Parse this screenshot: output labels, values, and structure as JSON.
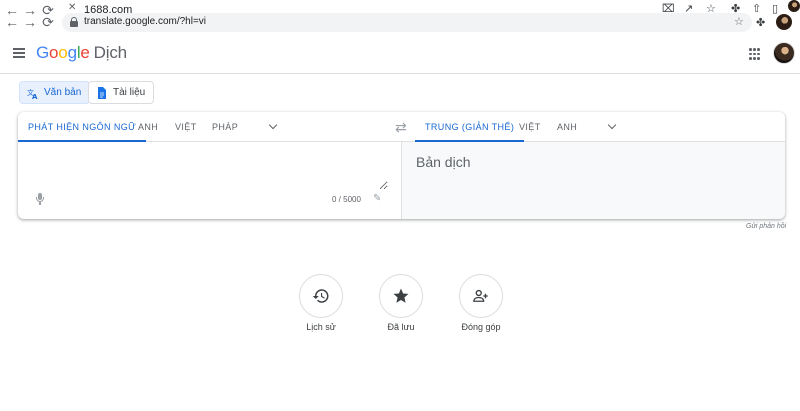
{
  "browser": {
    "tab_title": "1688.com",
    "url": "translate.google.com/?hl=vi"
  },
  "header": {
    "logo_letters": [
      "G",
      "o",
      "o",
      "g",
      "l",
      "e"
    ],
    "product_name": "Dịch"
  },
  "modes": [
    {
      "label": "Văn bản",
      "active": true,
      "icon": "translate-icon"
    },
    {
      "label": "Tài liệu",
      "active": false,
      "icon": "document-icon"
    }
  ],
  "source_langs": [
    {
      "label": "Phát hiện ngôn ngữ",
      "active": true
    },
    {
      "label": "Anh",
      "active": false
    },
    {
      "label": "Việt",
      "active": false
    },
    {
      "label": "Pháp",
      "active": false
    }
  ],
  "target_langs": [
    {
      "label": "Trung (Giản thể)",
      "active": true
    },
    {
      "label": "Việt",
      "active": false
    },
    {
      "label": "Anh",
      "active": false
    }
  ],
  "source": {
    "value": "",
    "char_count": "0 / 5000"
  },
  "target": {
    "placeholder": "Bản dịch"
  },
  "feedback_label": "Gửi phản hồi",
  "shortcuts": [
    {
      "label": "Lịch sử",
      "icon": "history-icon"
    },
    {
      "label": "Đã lưu",
      "icon": "star-icon"
    },
    {
      "label": "Đóng góp",
      "icon": "contribute-icon"
    }
  ],
  "colors": {
    "accent": "#1967d2",
    "active_mode_bg": "#e8f0fe"
  }
}
